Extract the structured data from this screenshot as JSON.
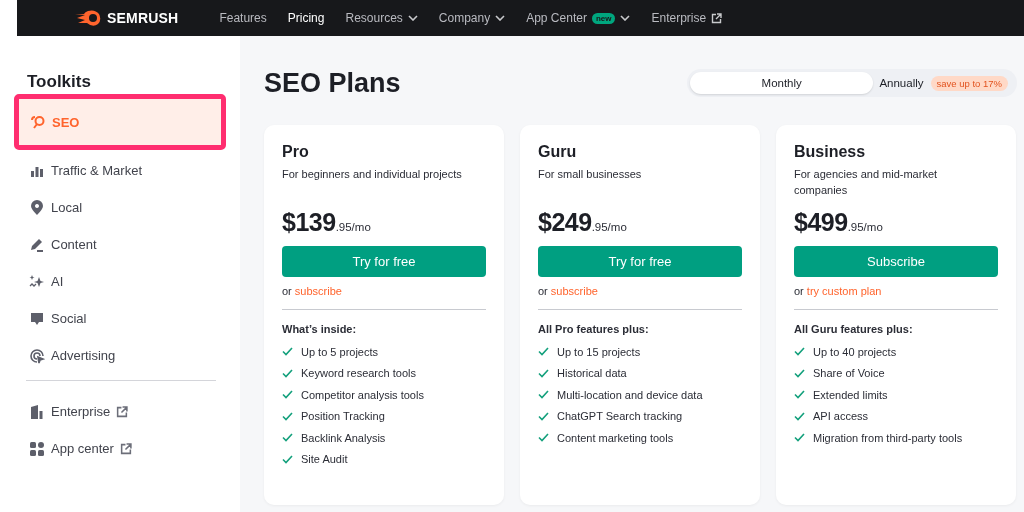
{
  "topbar": {
    "logo": "SEMRUSH",
    "nav": [
      {
        "label": "Features",
        "selected": false,
        "dropdown": false,
        "external": false
      },
      {
        "label": "Pricing",
        "selected": true,
        "dropdown": false,
        "external": false
      },
      {
        "label": "Resources",
        "selected": false,
        "dropdown": true,
        "external": false
      },
      {
        "label": "Company",
        "selected": false,
        "dropdown": true,
        "external": false
      },
      {
        "label": "App Center",
        "selected": false,
        "dropdown": true,
        "external": false,
        "badge": "new"
      },
      {
        "label": "Enterprise",
        "selected": false,
        "dropdown": false,
        "external": true
      }
    ]
  },
  "sidebar": {
    "title": "Toolkits",
    "items": [
      {
        "label": "SEO",
        "selected": true
      },
      {
        "label": "Traffic & Market",
        "selected": false
      },
      {
        "label": "Local",
        "selected": false
      },
      {
        "label": "Content",
        "selected": false
      },
      {
        "label": "AI",
        "selected": false
      },
      {
        "label": "Social",
        "selected": false
      },
      {
        "label": "Advertising",
        "selected": false
      }
    ],
    "links": [
      {
        "label": "Enterprise",
        "external": true
      },
      {
        "label": "App center",
        "external": true
      }
    ]
  },
  "main": {
    "title": "SEO Plans",
    "billing": [
      {
        "label": "Monthly",
        "selected": true
      },
      {
        "label": "Annually",
        "selected": false,
        "badge": "save up to 17%"
      }
    ],
    "plans": [
      {
        "name": "Pro",
        "description": "For beginners and individual projects",
        "price": "$139",
        "cents": ".95/mo",
        "cta": "Try for free",
        "alt_prefix": "or",
        "alt_link": "subscribe",
        "features_heading": "What’s inside:",
        "features": [
          "Up to 5 projects",
          "Keyword research tools",
          "Competitor analysis tools",
          "Position Tracking",
          "Backlink Analysis",
          "Site Audit"
        ]
      },
      {
        "name": "Guru",
        "description": "For small businesses",
        "price": "$249",
        "cents": ".95/mo",
        "cta": "Try for free",
        "alt_prefix": "or",
        "alt_link": "subscribe",
        "features_heading": "All Pro features plus:",
        "features": [
          "Up to 15 projects",
          "Historical data",
          "Multi-location and device data",
          "ChatGPT Search tracking",
          "Content marketing tools"
        ]
      },
      {
        "name": "Business",
        "description": "For agencies and mid-market companies",
        "price": "$499",
        "cents": ".95/mo",
        "cta": "Subscribe",
        "alt_prefix": "or",
        "alt_link": "try custom plan",
        "features_heading": "All Guru features plus:",
        "features": [
          "Up to 40 projects",
          "Share of Voice",
          "Extended limits",
          "API access",
          "Migration from third-party tools"
        ]
      }
    ]
  }
}
